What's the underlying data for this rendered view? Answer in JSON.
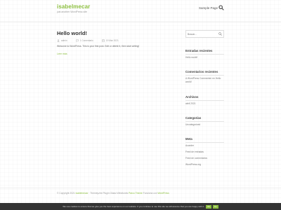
{
  "colors": {
    "accent": "#8cbf3f",
    "footer_bar": "#333333",
    "title_text": "#333333"
  },
  "header": {
    "site_title": "isabelmecar",
    "tagline": "just another WordPress site",
    "nav": [
      {
        "label": "Sample Page"
      }
    ],
    "search_icon": "search-icon"
  },
  "post": {
    "title": "Hello world!",
    "author": "admin",
    "comments": "1 Comentario",
    "date": "19 Mar 2021",
    "excerpt": "Welcome to WordPress. This is your first post. Edit or delete it, then start writing!",
    "read_more": "Leer más"
  },
  "sidebar": {
    "search_placeholder": "Buscar...",
    "widgets": [
      {
        "title": "Entradas recientes",
        "items": [
          "Hello world!"
        ]
      },
      {
        "title": "Comentarios recientes",
        "items": [
          "A WordPress Commenter en Hello",
          "world!"
        ]
      },
      {
        "title": "Archivos",
        "items": [
          "abril 2021"
        ]
      },
      {
        "title": "Categorías",
        "items": [
          "Uncategorized"
        ]
      },
      {
        "title": "Meta",
        "items": [
          "Acceder",
          "Feed de entradas",
          "Feed de comentarios",
          "WordPress.org"
        ]
      }
    ]
  },
  "footer": {
    "prefix": "© Copyright 2021",
    "site_link": "isabelmecar",
    "mid": "· Themeyzhe Plugin Glassi Windtunes",
    "theme_link": "Parco Theme",
    "powered": "Funciona con",
    "wp_link": "WordPress"
  },
  "cookie": {
    "text": "We use cookies to ensure that we give you the best experience on our website. If you continue to use this site we will assume that you are happy with it.",
    "ok_label": "Ok",
    "more_label": "No"
  }
}
